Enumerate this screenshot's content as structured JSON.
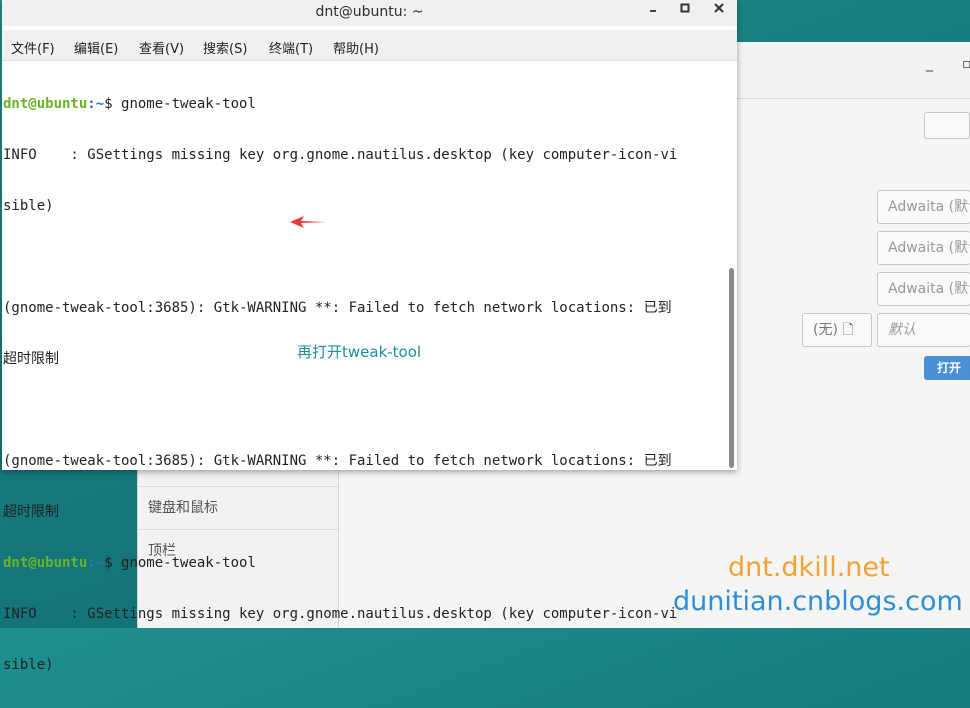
{
  "terminal": {
    "title": "dnt@ubuntu: ~",
    "controls": {
      "minimize": "▫",
      "maximize": "▫",
      "close": "✕"
    },
    "menu": [
      "文件(F)",
      "编辑(E)",
      "查看(V)",
      "搜索(S)",
      "终端(T)",
      "帮助(H)"
    ],
    "prompt_user": "dnt@ubuntu",
    "prompt_path": ":~",
    "prompt_symbol": "$",
    "lines": {
      "cmd1": " gnome-tweak-tool",
      "info1a": "INFO    : GSettings missing key org.gnome.nautilus.desktop (key computer-icon-vi",
      "info1b": "sible)",
      "warn1a": "(gnome-tweak-tool:3685): Gtk-WARNING **: Failed to fetch network locations: 已到",
      "warn1b": "超时限制",
      "warn2a": "(gnome-tweak-tool:3685): Gtk-WARNING **: Failed to fetch network locations: 已到",
      "warn2b": "超时限制",
      "cmd2": " gnome-tweak-tool",
      "info2a": "INFO    : GSettings missing key org.gnome.nautilus.desktop (key computer-icon-vi",
      "info2b": "sible)"
    },
    "annotation": "再打开tweak-tool"
  },
  "tweak": {
    "sidebar": [
      "键盘和鼠标",
      "顶栏"
    ],
    "fields": {
      "theme1": "Adwaita (默认)",
      "theme2": "Adwaita (默认)",
      "theme3": "Adwaita (默认)",
      "none_label": "(无)",
      "default_label": "默认"
    },
    "open_button": "打开"
  },
  "watermarks": [
    "dnt.dkill.net",
    "dunitian.cnblogs.com"
  ],
  "colors": {
    "prompt_user": "#6ab425",
    "prompt_path": "#3a6fc0",
    "arrow": "#e8383d",
    "accent_button": "#4a90d9"
  }
}
